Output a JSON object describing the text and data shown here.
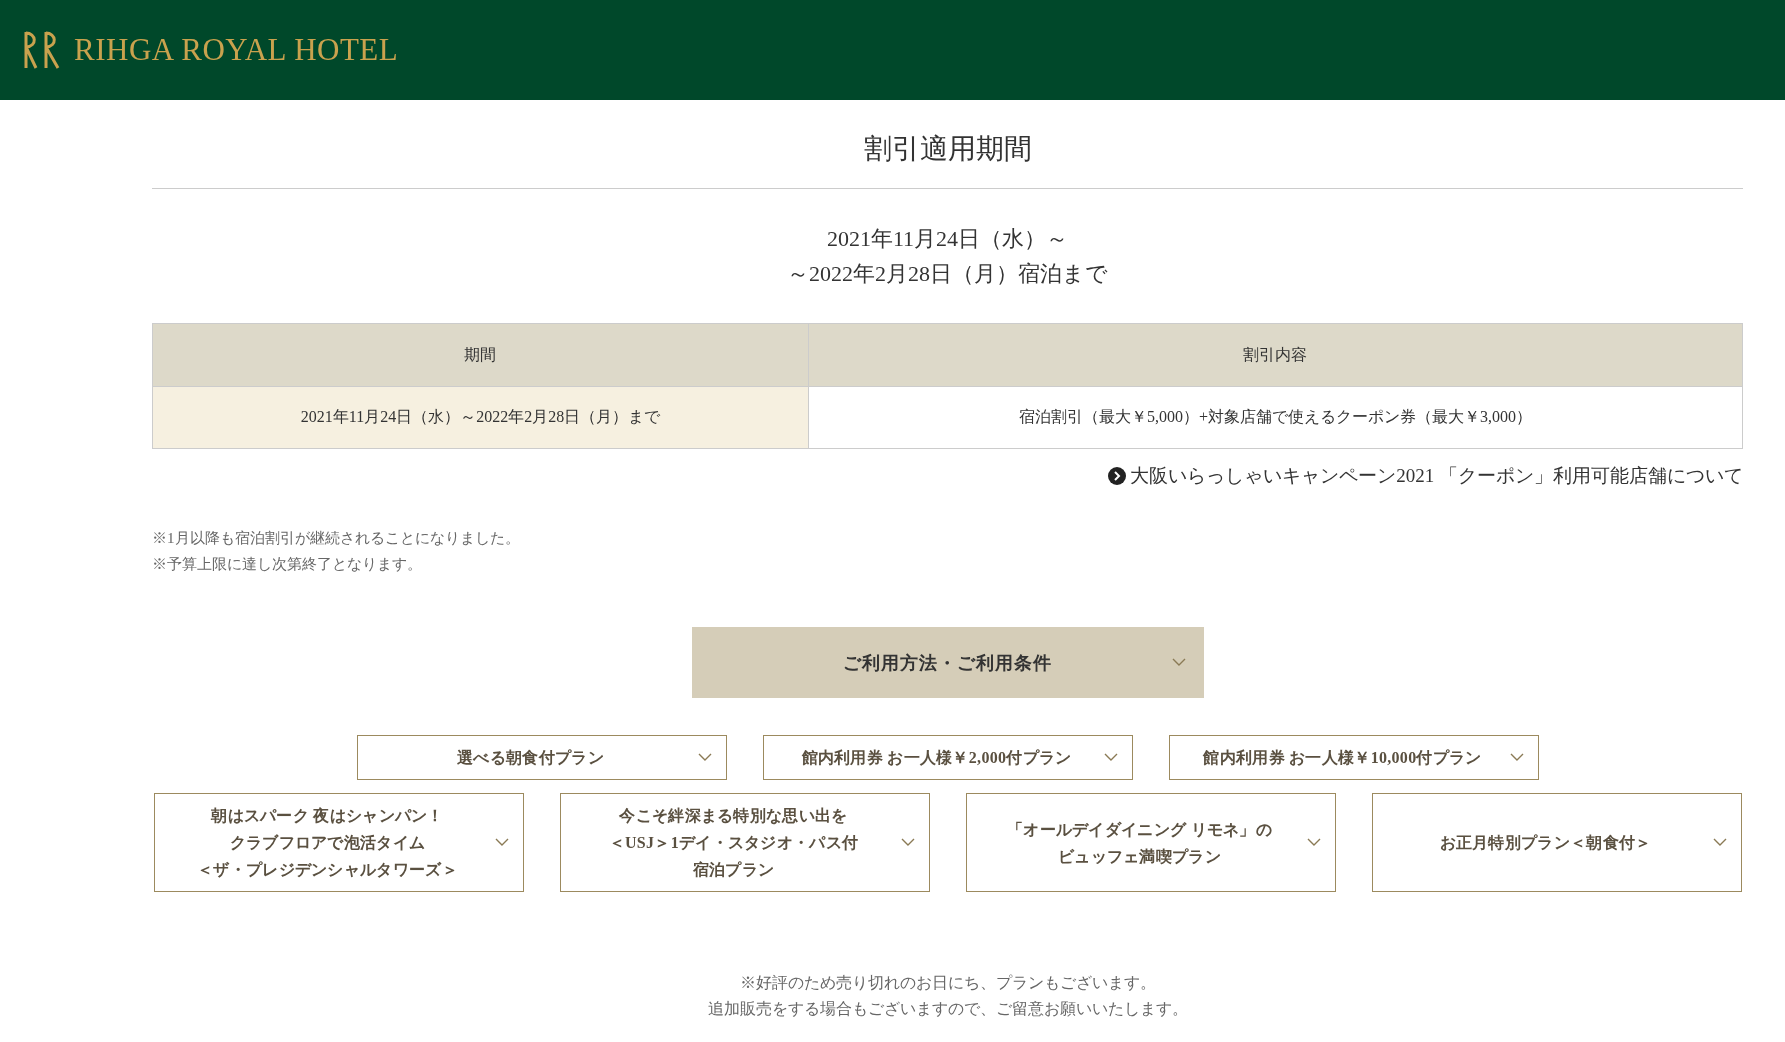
{
  "header": {
    "logo_text": "RIHGA ROYAL HOTEL"
  },
  "section": {
    "title": "割引適用期間",
    "period_lines": [
      "2021年11月24日（水）～",
      "～2022年2月28日（月）宿泊まで"
    ]
  },
  "table": {
    "columns": [
      "期間",
      "割引内容"
    ],
    "rows": [
      [
        "2021年11月24日（水）～2022年2月28日（月）まで",
        "宿泊割引（最大￥5,000）+対象店舗で使えるクーポン券（最大￥3,000）"
      ]
    ]
  },
  "link": {
    "label": "大阪いらっしゃいキャンペーン2021 「クーポン」利用可能店舗について"
  },
  "notes": [
    "※1月以降も宿泊割引が継続されることになりました。",
    "※予算上限に達し次第終了となります。"
  ],
  "usage_accordion": {
    "label": "ご利用方法・ご利用条件",
    "expanded": false
  },
  "plan_rows": [
    [
      {
        "lines": [
          "選べる朝食付プラン"
        ],
        "expanded": false
      },
      {
        "lines": [
          "館内利用券 お一人様￥2,000付プラン"
        ],
        "expanded": false
      },
      {
        "lines": [
          "館内利用券 お一人様￥10,000付プラン"
        ],
        "expanded": false
      }
    ],
    [
      {
        "lines": [
          "朝はスパーク 夜はシャンパン！",
          "クラブフロアで泡活タイム",
          "＜ザ・プレジデンシャルタワーズ＞"
        ],
        "expanded": false
      },
      {
        "lines": [
          "今こそ絆深まる特別な思い出を",
          "＜USJ＞1デイ・スタジオ・パス付",
          "宿泊プラン"
        ],
        "expanded": false
      },
      {
        "lines": [
          "「オールデイダイニング リモネ」の",
          "ビュッフェ満喫プラン"
        ],
        "expanded": false
      },
      {
        "lines": [
          "お正月特別プラン＜朝食付＞"
        ],
        "expanded": false
      }
    ]
  ],
  "footer_notes": [
    "※好評のため売り切れのお日にち、プランもございます。",
    "追加販売をする場合もございますので、ご留意お願いいたします。"
  ]
}
